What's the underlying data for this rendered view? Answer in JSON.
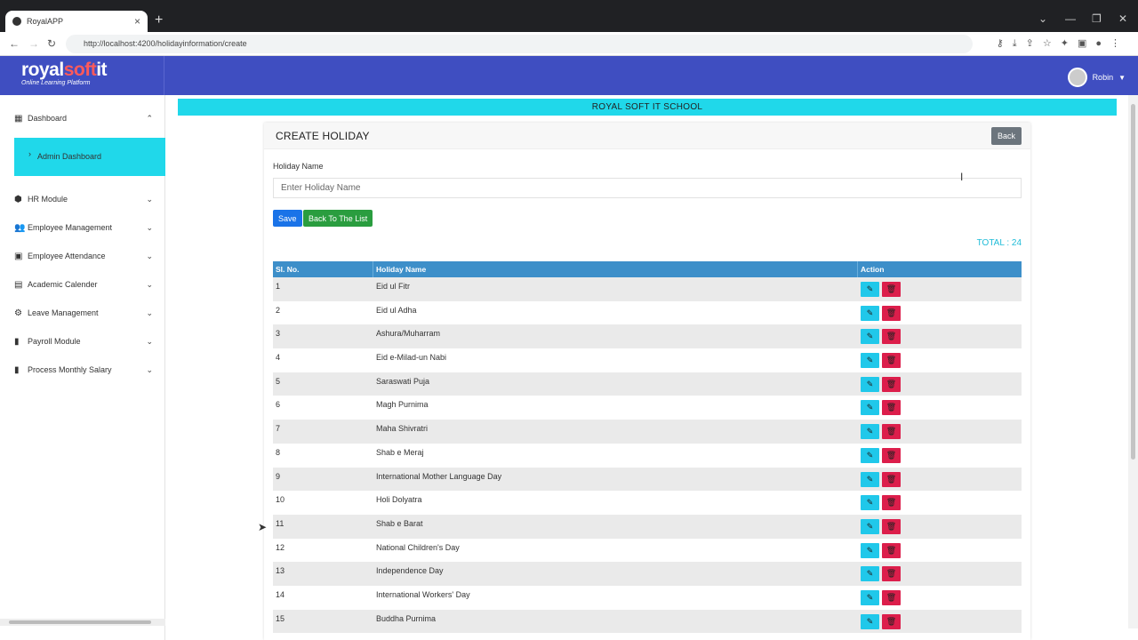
{
  "browser": {
    "tab_title": "RoyalAPP",
    "url": "http://localhost:4200/holidayinformation/create"
  },
  "header": {
    "logo_royal": "royal",
    "logo_soft": "soft",
    "logo_it": "it",
    "logo_tagline": "Online Learning Platform",
    "user_name": "Robin"
  },
  "sidebar": {
    "dashboard": "Dashboard",
    "admin_dashboard": "Admin Dashboard",
    "items": [
      {
        "label": "HR Module",
        "icon": "hr-icon"
      },
      {
        "label": "Employee Management",
        "icon": "people-icon"
      },
      {
        "label": "Employee Attendance",
        "icon": "attendance-icon"
      },
      {
        "label": "Academic Calender",
        "icon": "calendar-icon"
      },
      {
        "label": "Leave Management",
        "icon": "gear-icon"
      },
      {
        "label": "Payroll Module",
        "icon": "payroll-icon"
      },
      {
        "label": "Process Monthly Salary",
        "icon": "salary-icon"
      }
    ]
  },
  "main": {
    "school_name": "ROYAL SOFT IT SCHOOL",
    "card_title": "CREATE HOLIDAY",
    "back_label": "Back",
    "field_label": "Holiday Name",
    "field_placeholder": "Enter Holiday Name",
    "save_label": "Save",
    "back_to_list_label": "Back To The List",
    "total": "TOTAL : 24",
    "table_headers": [
      "Sl. No.",
      "Holiday Name",
      "Action"
    ],
    "rows": [
      {
        "no": "1",
        "name": "Eid ul Fitr"
      },
      {
        "no": "2",
        "name": "Eid ul Adha"
      },
      {
        "no": "3",
        "name": "Ashura/Muharram"
      },
      {
        "no": "4",
        "name": "Eid e-Milad-un Nabi"
      },
      {
        "no": "5",
        "name": "Saraswati Puja"
      },
      {
        "no": "6",
        "name": "Magh Purnima"
      },
      {
        "no": "7",
        "name": "Maha Shivratri"
      },
      {
        "no": "8",
        "name": "Shab e Meraj"
      },
      {
        "no": "9",
        "name": "International Mother Language Day"
      },
      {
        "no": "10",
        "name": "Holi Dolyatra"
      },
      {
        "no": "11",
        "name": "Shab e Barat"
      },
      {
        "no": "12",
        "name": "National Children's Day"
      },
      {
        "no": "13",
        "name": "Independence Day"
      },
      {
        "no": "14",
        "name": "International Workers' Day"
      },
      {
        "no": "15",
        "name": "Buddha Purnima"
      }
    ]
  },
  "colors": {
    "header_blue": "#3f4ec1",
    "accent_cyan": "#20d8ea",
    "table_header": "#3d8fc9",
    "save_blue": "#1a73e8",
    "list_green": "#2a9d3f",
    "delete_red": "#dc1e4b"
  }
}
